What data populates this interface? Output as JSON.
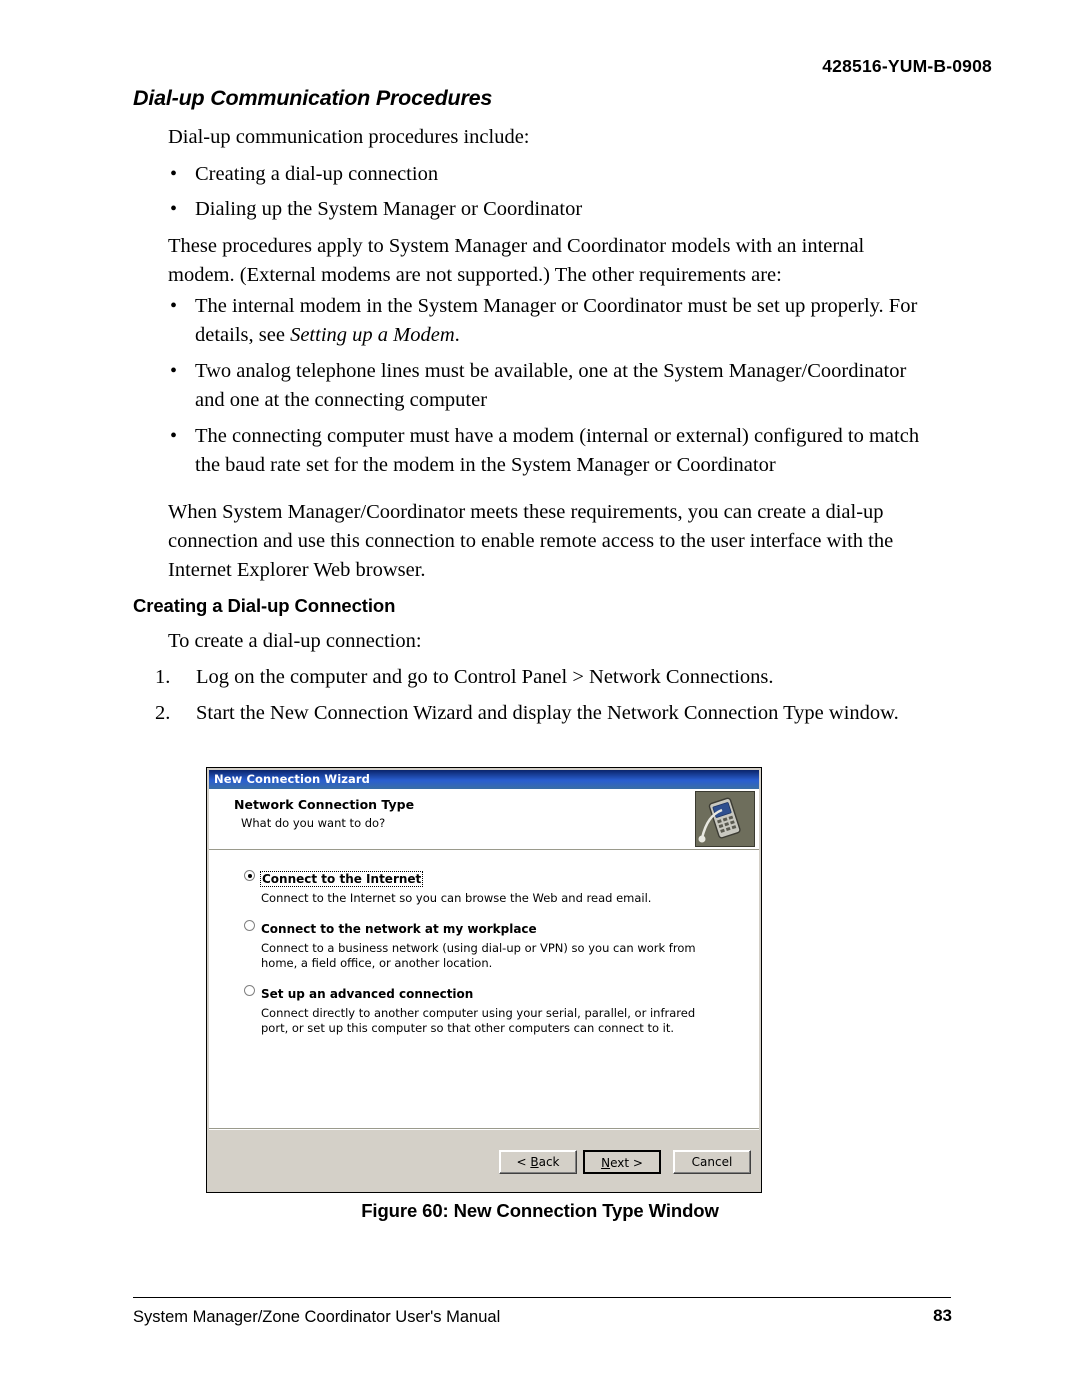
{
  "header": {
    "doc_number": "428516-YUM-B-0908"
  },
  "section": {
    "title": "Dial-up Communication Procedures",
    "intro": "Dial-up communication procedures include:",
    "intro_bullets": [
      "Creating a dial-up connection",
      "Dialing up the System Manager or Coordinator"
    ],
    "paragraph_1": "These procedures apply to System Manager and Coordinator models with an internal modem. (External modems are not supported.) The other requirements are:",
    "requirement_bullets": [
      {
        "text_before": "The internal modem in the System Manager or Coordinator must be set up properly. For details, see ",
        "italic": "Setting up a Modem",
        "text_after": "."
      },
      {
        "text_before": "Two analog telephone lines must be available, one at the System Manager/Coordinator and one at the connecting computer",
        "italic": "",
        "text_after": ""
      },
      {
        "text_before": "The connecting computer must have a modem (internal or external) configured to match the baud rate set for the modem in the System Manager or Coordinator",
        "italic": "",
        "text_after": ""
      }
    ],
    "paragraph_2": "When System Manager/Coordinator meets these requirements, you can create a dial-up connection and use this connection to enable remote access to the user interface with the Internet Explorer Web browser."
  },
  "subsection": {
    "title": "Creating a Dial-up Connection",
    "lead_in": "To create a dial-up connection:",
    "steps": [
      {
        "num": "1.",
        "text": "Log on the computer and go to Control Panel > Network Connections."
      },
      {
        "num": "2.",
        "text": "Start the New Connection Wizard and display the Network Connection Type window."
      }
    ]
  },
  "wizard": {
    "window_title": "New Connection Wizard",
    "heading": "Network Connection Type",
    "subheading": "What do you want to do?",
    "options": [
      {
        "label": "Connect to the Internet",
        "selected": true,
        "description": "Connect to the Internet so you can browse the Web and read email."
      },
      {
        "label": "Connect to the network at my workplace",
        "selected": false,
        "description": "Connect to a business network (using dial-up or VPN) so you can work from home, a field office, or another location."
      },
      {
        "label": "Set up an advanced connection",
        "selected": false,
        "description": "Connect directly to another computer using your serial, parallel, or infrared port, or set up this computer so that other computers can connect to it."
      }
    ],
    "buttons": {
      "back": "< Back",
      "next": "Next >",
      "cancel": "Cancel"
    }
  },
  "figure": {
    "caption": "Figure 60: New Connection Type Window"
  },
  "footer": {
    "left": "System Manager/Zone Coordinator User's Manual",
    "page_number": "83"
  }
}
